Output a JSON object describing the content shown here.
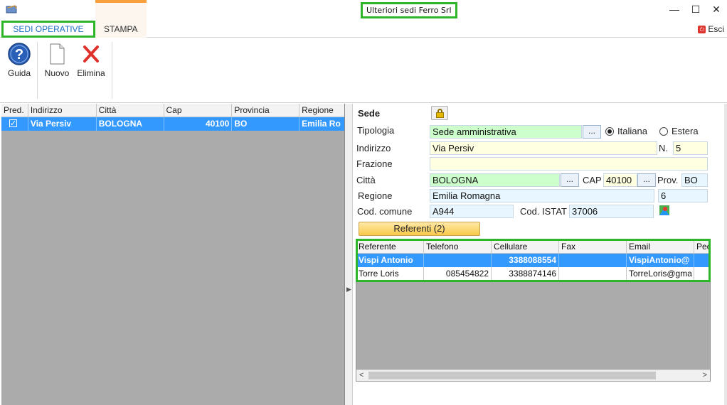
{
  "window": {
    "title": "Ulteriori sedi Ferro Srl",
    "minimize_glyph": "—",
    "maximize_glyph": "☐",
    "close_glyph": "✕"
  },
  "tabs": {
    "sedi_operative": "SEDI OPERATIVE",
    "stampa": "STAMPA",
    "esci": "Esci"
  },
  "ribbon": {
    "guida": "Guida",
    "nuovo": "Nuovo",
    "elimina": "Elimina"
  },
  "sedi_grid": {
    "columns": [
      "Pred.",
      "Indirizzo",
      "Città",
      "Cap",
      "Provincia",
      "Regione"
    ],
    "rows": [
      {
        "pred": true,
        "indirizzo": "Via Persiv",
        "citta": "BOLOGNA",
        "cap": "40100",
        "provincia": "BO",
        "regione": "Emilia Ro"
      }
    ]
  },
  "form": {
    "sede_label": "Sede",
    "tipologia_label": "Tipologia",
    "tipologia_value": "Sede amministrativa",
    "radio_italiana": "Italiana",
    "radio_estera": "Estera",
    "indirizzo_label": "Indirizzo",
    "indirizzo_value": "Via Persiv",
    "numero_label": "N.",
    "numero_value": "5",
    "frazione_label": "Frazione",
    "frazione_value": "",
    "citta_label": "Città",
    "citta_value": "BOLOGNA",
    "cap_label": "CAP",
    "cap_value": "40100",
    "prov_label": "Prov.",
    "prov_value": "BO",
    "regione_label": "Regione",
    "regione_value": "Emilia Romagna",
    "regione_code": "6",
    "cod_comune_label": "Cod. comune",
    "cod_comune_value": "A944",
    "cod_istat_label": "Cod. ISTAT",
    "cod_istat_value": "37006",
    "dots": "...",
    "referenti_button": "Referenti (2)"
  },
  "referenti_grid": {
    "columns": [
      "Referente",
      "Telefono",
      "Cellulare",
      "Fax",
      "Email",
      "Pec"
    ],
    "rows": [
      {
        "referente": "Vispi Antonio",
        "telefono": "",
        "cellulare": "3388088554",
        "fax": "",
        "email": "VispiAntonio@",
        "pec": ""
      },
      {
        "referente": "Torre Loris",
        "telefono": "085454822",
        "cellulare": "3388874146",
        "fax": "",
        "email": "TorreLoris@gma",
        "pec": ""
      }
    ]
  },
  "colors": {
    "highlight_green": "#2fb52a",
    "selection_blue": "#3399ff",
    "tab_blue": "#1d6fc4",
    "field_green": "#ccffcc",
    "field_yellow": "#ffffe1"
  }
}
